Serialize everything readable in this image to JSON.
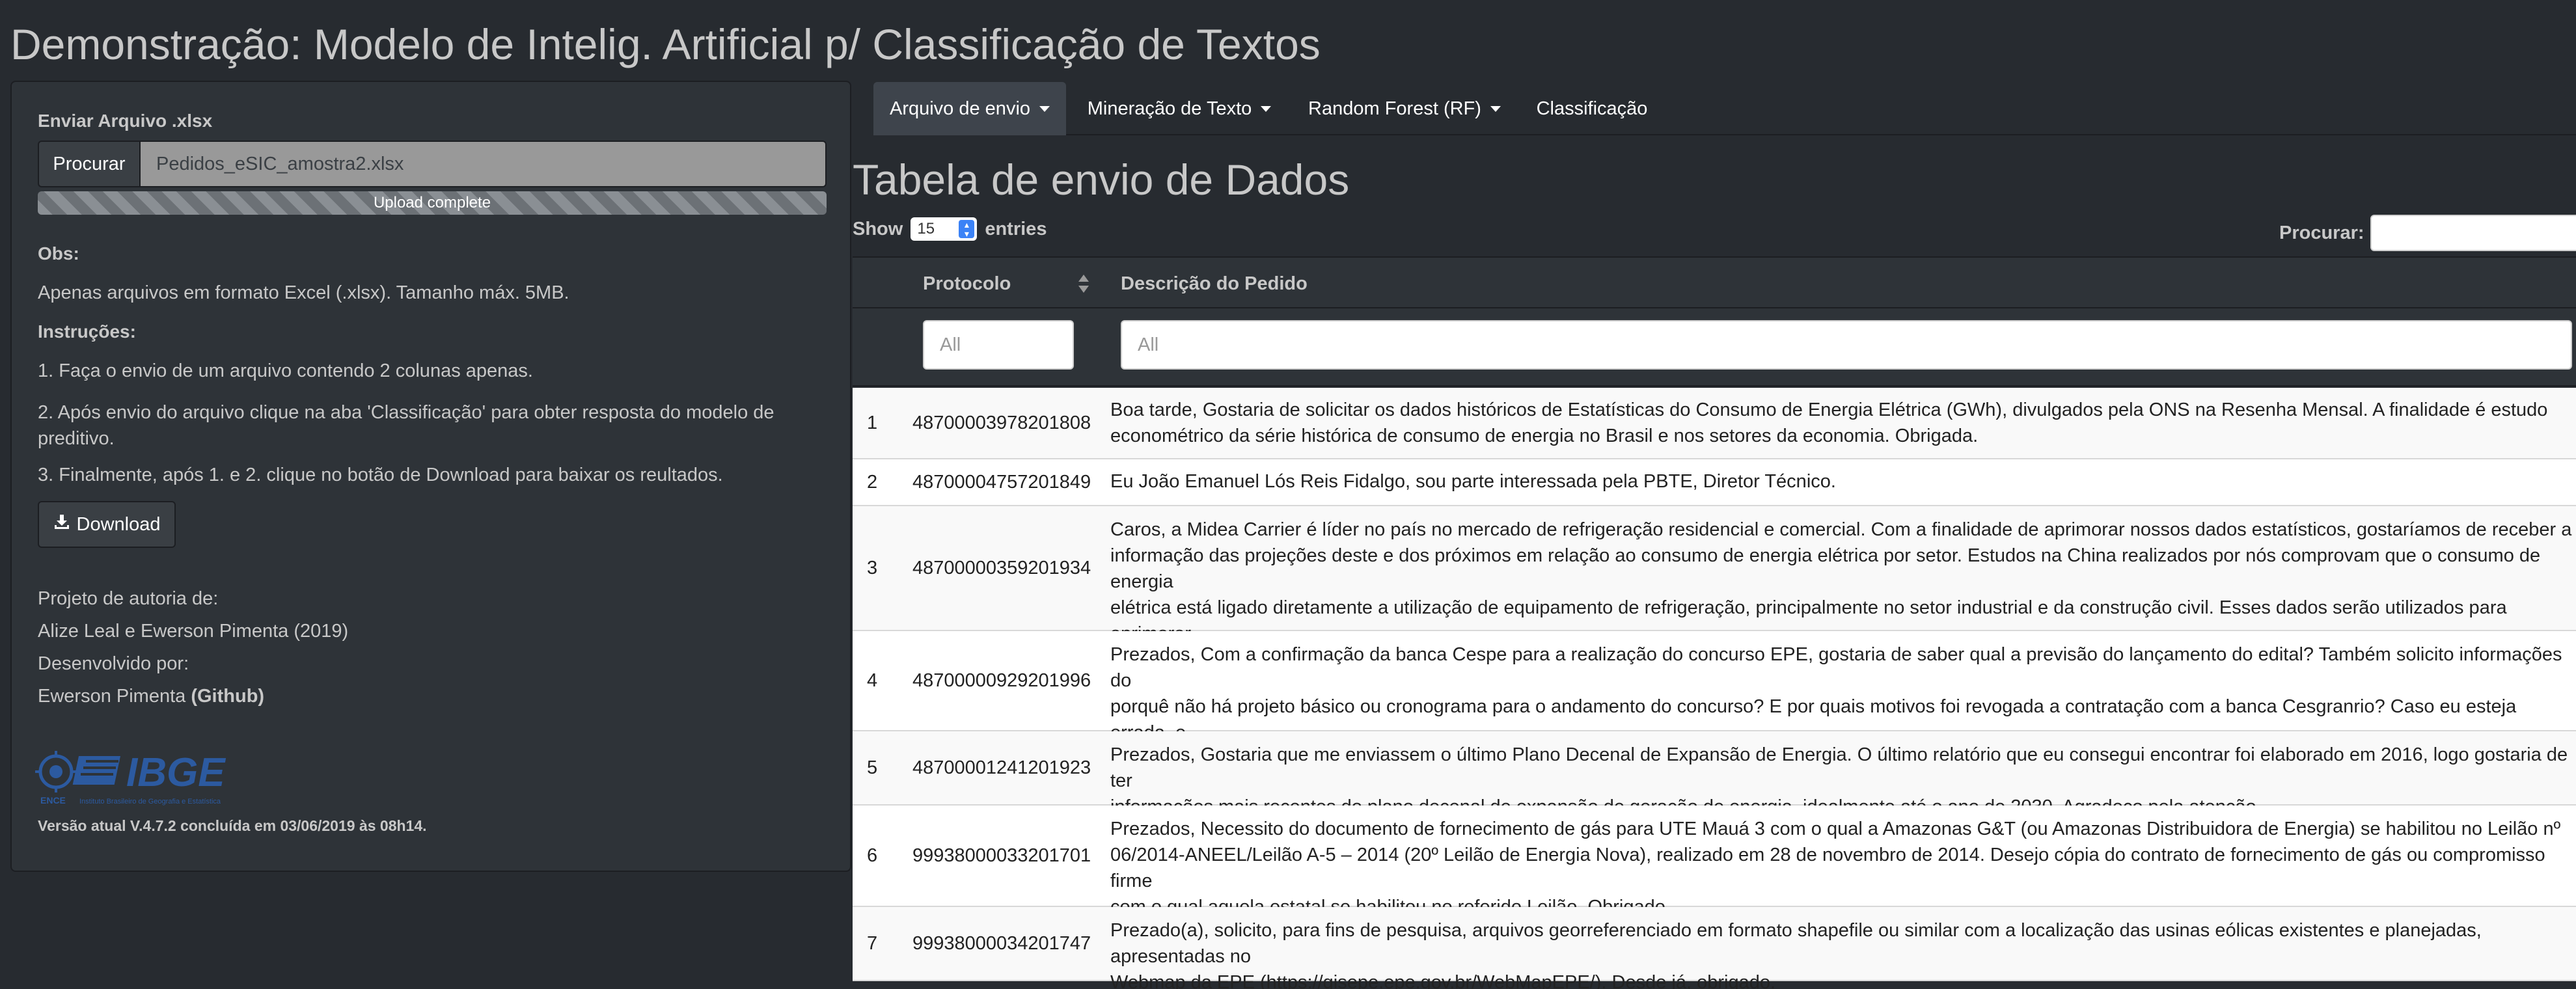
{
  "app": {
    "title": "Demonstração: Modelo de Intelig. Artificial p/ Classificação de Textos"
  },
  "sidebar": {
    "upload_label": "Enviar Arquivo .xlsx",
    "browse_label": "Procurar",
    "file_name": "Pedidos_eSIC_amostra2.xlsx",
    "progress_text": "Upload complete",
    "progress": 1.0,
    "obs_heading": "Obs:",
    "obs_text": "Apenas arquivos em formato Excel (.xlsx). Tamanho máx. 5MB.",
    "instructions_heading": "Instruções:",
    "instruction_1": "1. Faça o envio de um arquivo contendo 2 colunas apenas.",
    "instruction_2": "2. Após envio do arquivo clique na aba 'Classificação' para obter resposta do modelo de\npreditivo.",
    "instruction_3": "3. Finalmente, após 1. e 2. clique no botão de Download para baixar os reultados.",
    "download_label": "Download",
    "authorship_heading": "Projeto de autoria de:",
    "authors": "Alize Leal e Ewerson Pimenta (2019)",
    "developed_heading": "Desenvolvido por:",
    "developer": "Ewerson Pimenta",
    "github_label": "(Github)",
    "logo_primary": "IBGE",
    "logo_secondary": "ENCE",
    "logo_subtitle": "Instituto Brasileiro de Geografia e Estatística",
    "version": "Versão atual V.4.7.2 concluída em 03/06/2019 às 08h14."
  },
  "nav": {
    "tabs": [
      {
        "label": "Arquivo de envio",
        "dropdown": true,
        "active": true
      },
      {
        "label": "Mineração de Texto",
        "dropdown": true,
        "active": false
      },
      {
        "label": "Random Forest (RF)",
        "dropdown": true,
        "active": false
      },
      {
        "label": "Classificação",
        "dropdown": false,
        "active": false
      }
    ]
  },
  "main": {
    "heading": "Tabela de envio de Dados",
    "show_label": "Show",
    "entries_value": "15",
    "entries_label": "entries",
    "search_label": "Procurar:",
    "search_value": ""
  },
  "table": {
    "columns": [
      "Protocolo",
      "Descrição do Pedido"
    ],
    "filter_placeholders": [
      "All",
      "All"
    ],
    "rows": [
      {
        "index": "1",
        "protocolo": "48700003978201808",
        "descricao": "Boa tarde, Gostaria de solicitar os dados históricos de Estatísticas do Consumo de Energia Elétrica (GWh), divulgados pela ONS na Resenha Mensal. A finalidade é estudo\neconométrico da série histórica de consumo de energia no Brasil e nos setores da economia. Obrigada."
      },
      {
        "index": "2",
        "protocolo": "48700004757201849",
        "descricao": "Eu João Emanuel Lós Reis Fidalgo, sou parte interessada pela PBTE, Diretor Técnico."
      },
      {
        "index": "3",
        "protocolo": "48700000359201934",
        "descricao": "Caros, a Midea Carrier é líder no país no mercado de refrigeração residencial e comercial. Com a finalidade de aprimorar nossos dados estatísticos, gostaríamos de receber a\ninformação das projeções deste e dos próximos em relação ao consumo de energia elétrica por setor. Estudos na China realizados por nós comprovam que o consumo de energia\nelétrica está ligado diretamente a utilização de equipamento de refrigeração, principalmente no setor industrial e da construção civil. Esses dados serão utilizados para aprimorar\nnosso planejamento de produção/ venda e no desenvolvimento de produtos mais eficientes energeticamente."
      },
      {
        "index": "4",
        "protocolo": "48700000929201996",
        "descricao": "Prezados, Com a confirmação da banca Cespe para a realização do concurso EPE, gostaria de saber qual a previsão do lançamento do edital? Também solicito informações do\nporquê não há projeto básico ou cronograma para o andamento do concurso? E por quais motivos foi revogada a contratação com a banca Cesgranrio? Caso eu esteja errada, e\nhá um cronograma do concurso, poderiam me enviar em anexo, por gentileza?"
      },
      {
        "index": "5",
        "protocolo": "48700001241201923",
        "descricao": "Prezados, Gostaria que me enviassem o último Plano Decenal de Expansão de Energia. O último relatório que eu consegui encontrar foi elaborado em 2016, logo gostaria de ter\ninformações mais recentes do plano decenal de expansão de geração de energia, idealmente até o ano de 2030. Agradeço pela atenção."
      },
      {
        "index": "6",
        "protocolo": "99938000033201701",
        "descricao": "Prezados, Necessito do documento de fornecimento de gás para UTE Mauá 3 com o qual a Amazonas G&T (ou Amazonas Distribuidora de Energia) se habilitou no Leilão nº\n06/2014-ANEEL/Leilão A-5 – 2014 (20º Leilão de Energia Nova), realizado em 28 de novembro de 2014. Desejo cópia do contrato de fornecimento de gás ou compromisso firme\ncom o qual aquela estatal se habilitou no referido Leilão. Obrigado."
      },
      {
        "index": "7",
        "protocolo": "99938000034201747",
        "descricao": "Prezado(a), solicito, para fins de pesquisa, arquivos georreferenciado em formato shapefile ou similar com a localização das usinas eólicas existentes e planejadas, apresentadas no\nWebmap da EPE (https://gisepe.epe.gov.br/WebMapEPE/). Desde já, obrigado."
      }
    ]
  }
}
